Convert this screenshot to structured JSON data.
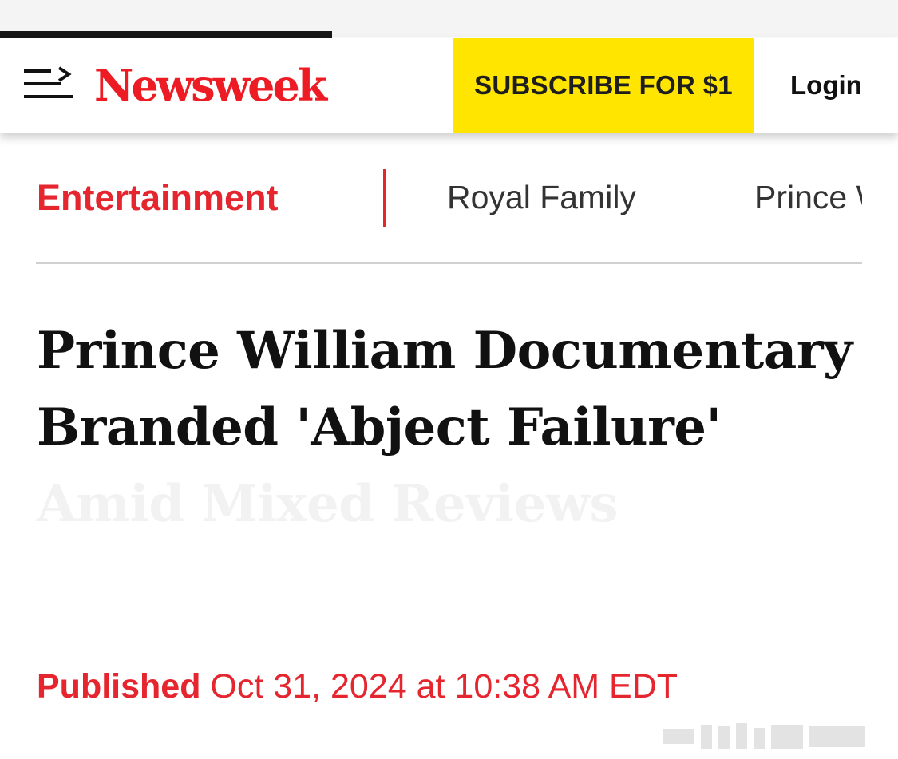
{
  "browser": {
    "reading_progress_percent": 37
  },
  "header": {
    "menu_icon": "menu-arrow-icon",
    "logo_text": "Newsweek",
    "subscribe_label": "SUBSCRIBE FOR $1",
    "login_label": "Login"
  },
  "subnav": {
    "active_label": "Entertainment",
    "items": [
      {
        "label": "Royal Family"
      },
      {
        "label": "Prince William"
      }
    ]
  },
  "article": {
    "headline_visible": "Prince William Documentary Branded 'Abject Failure'",
    "headline_faded": "Amid Mixed Reviews",
    "published_label": "Published",
    "published_date": "Oct 31, 2024 at 10:38 AM EDT"
  },
  "colors": {
    "brand_red": "#ed1c24",
    "section_red": "#e5262f",
    "subscribe_yellow": "#ffe500",
    "text_dark": "#111111",
    "divider_gray": "#d0d0d0"
  }
}
